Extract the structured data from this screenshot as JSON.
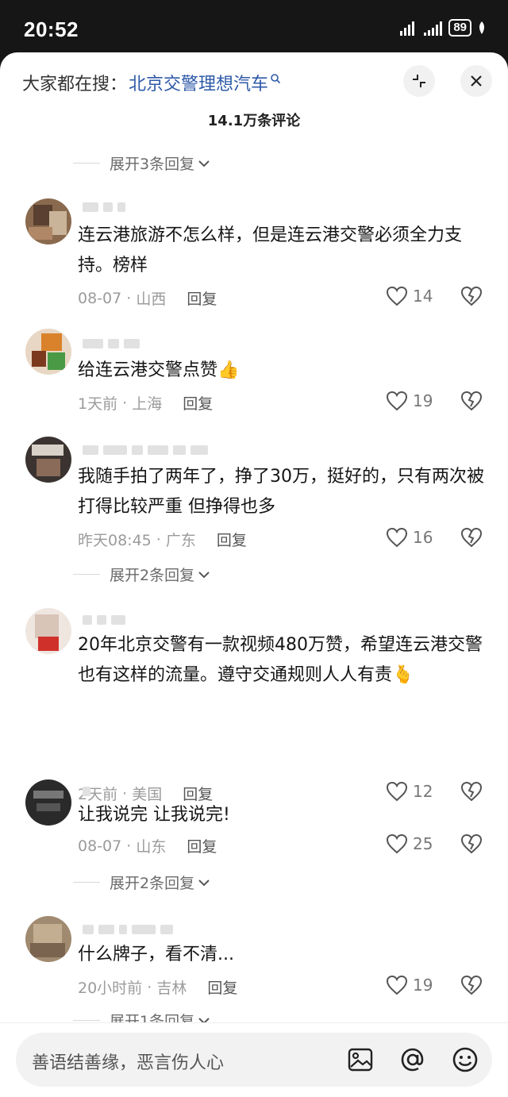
{
  "status": {
    "time": "20:52",
    "battery": "89"
  },
  "header": {
    "search_prefix": "大家都在搜：",
    "search_term": "北京交警理想汽车",
    "comment_count": "14.1万条评论"
  },
  "expand_labels": {
    "e1": "展开3条回复",
    "e2": "展开2条回复",
    "e3": "展开2条回复",
    "e4": "展开1条回复"
  },
  "comments": [
    {
      "text": "连云港旅游不怎么样，但是连云港交警必须全力支持。榜样",
      "time": "08-07",
      "location": "山西",
      "reply": "回复",
      "likes": "14"
    },
    {
      "text": "给连云港交警点赞👍",
      "time": "1天前",
      "location": "上海",
      "reply": "回复",
      "likes": "19"
    },
    {
      "text": "我随手拍了两年了，挣了30万，挺好的，只有两次被打得比较严重 但挣得也多",
      "time": "昨天08:45",
      "location": "广东",
      "reply": "回复",
      "likes": "16"
    },
    {
      "text": "20年北京交警有一款视频480万赞，希望连云港交警也有这样的流量。遵守交通规则人人有责🫰",
      "time": "2天前",
      "location": "美国",
      "reply": "回复",
      "likes": "12"
    },
    {
      "text": "让我说完 让我说完!",
      "time": "08-07",
      "location": "山东",
      "reply": "回复",
      "likes": "25"
    },
    {
      "text": "什么牌子，看不清...",
      "time": "20小时前",
      "location": "吉林",
      "reply": "回复",
      "likes": "19"
    }
  ],
  "input": {
    "placeholder": "善语结善缘，恶言伤人心"
  },
  "colors": {
    "link": "#2e5aa8",
    "meta": "#9b9b9b",
    "text": "#151515"
  }
}
